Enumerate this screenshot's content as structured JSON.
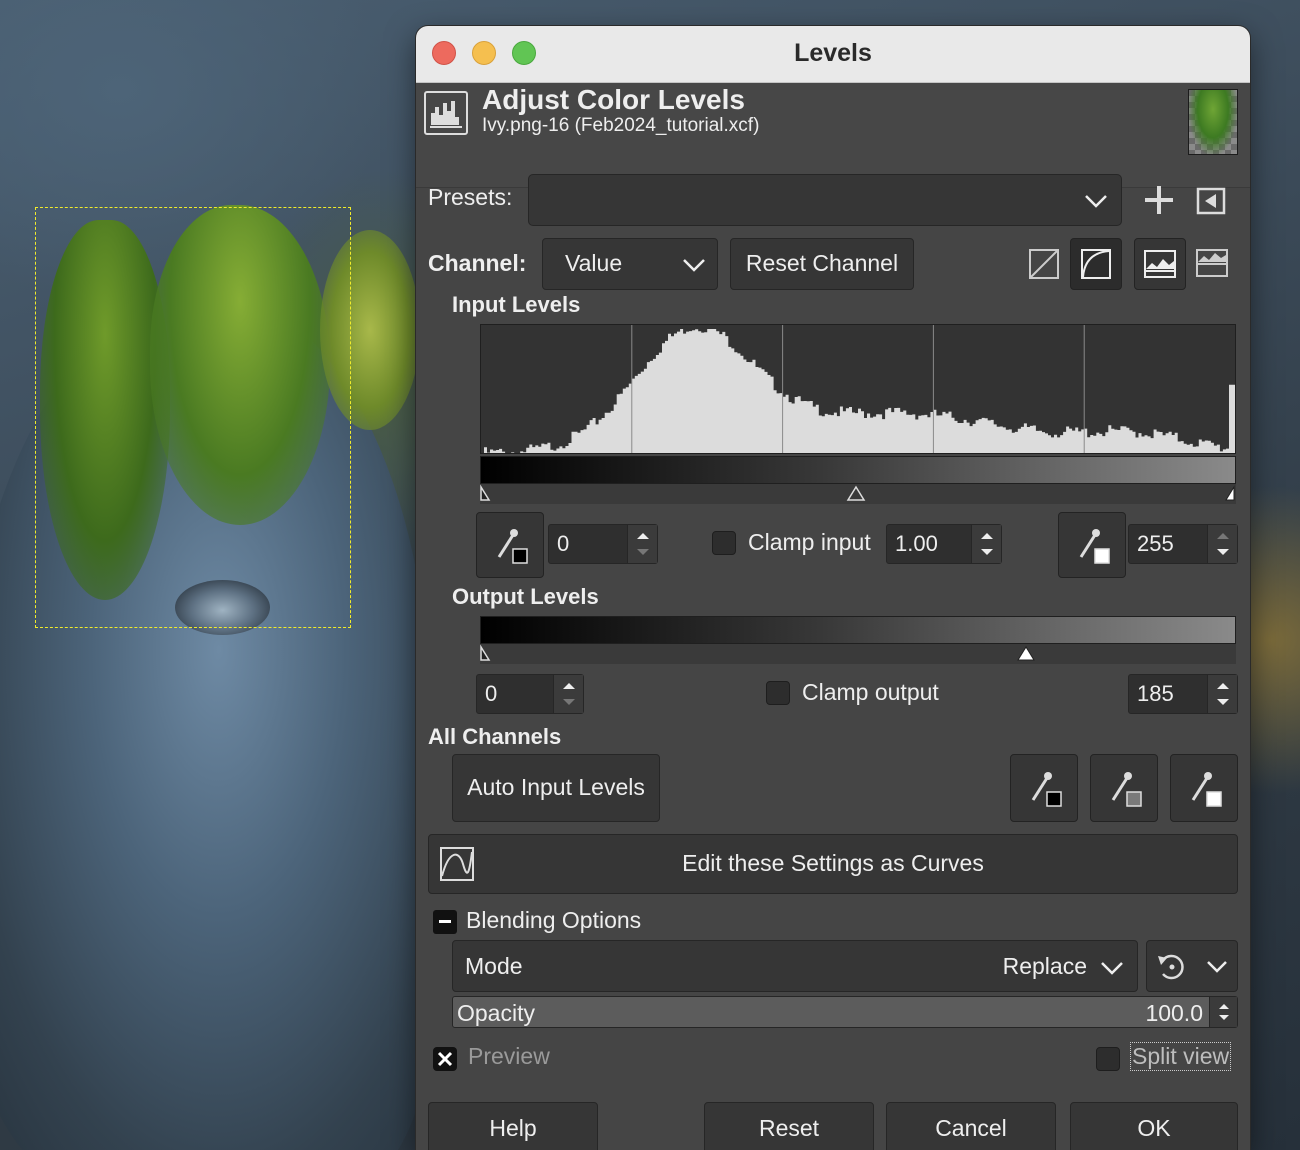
{
  "window": {
    "title": "Levels"
  },
  "header": {
    "title": "Adjust Color Levels",
    "subtitle": "Ivy.png-16 (Feb2024_tutorial.xcf)"
  },
  "presets": {
    "label": "Presets:",
    "value": ""
  },
  "channel": {
    "label": "Channel:",
    "value": "Value",
    "reset_label": "Reset Channel"
  },
  "input_levels": {
    "heading": "Input Levels",
    "low": "0",
    "gamma": "1.00",
    "high": "255",
    "clamp_label": "Clamp input",
    "clamp_checked": false
  },
  "output_levels": {
    "heading": "Output Levels",
    "low": "0",
    "high": "185",
    "clamp_label": "Clamp output",
    "clamp_checked": false
  },
  "all_channels": {
    "heading": "All Channels",
    "auto_label": "Auto Input Levels"
  },
  "curves_button": {
    "label": "Edit these Settings as Curves"
  },
  "blending": {
    "heading": "Blending Options",
    "mode_label": "Mode",
    "mode_value": "Replace",
    "opacity_label": "Opacity",
    "opacity_value": "100.0"
  },
  "preview": {
    "label": "Preview",
    "checked": true,
    "split_label": "Split view",
    "split_checked": false
  },
  "footer": {
    "help": "Help",
    "reset": "Reset",
    "cancel": "Cancel",
    "ok": "OK"
  },
  "icons": [
    "histogram-icon",
    "add-preset-icon",
    "preset-menu-icon",
    "linear-histogram-icon",
    "log-histogram-icon",
    "eyedropper-black-icon",
    "eyedropper-gray-icon",
    "eyedropper-white-icon",
    "curves-icon",
    "reset-mode-icon",
    "chevron-down-icon"
  ],
  "colors": {
    "dialog_bg": "#454545",
    "titlebar": "#e9e9e9",
    "selection": "#f1ec2a"
  }
}
